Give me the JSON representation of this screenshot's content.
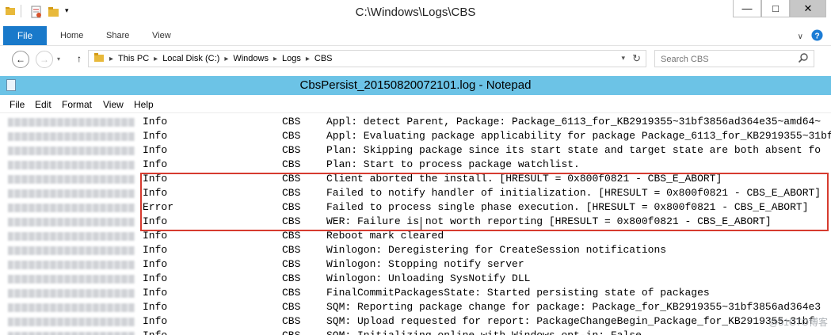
{
  "explorer": {
    "title": "C:\\Windows\\Logs\\CBS",
    "ribbon_tabs": [
      "File",
      "Home",
      "Share",
      "View"
    ],
    "address_crumbs": [
      "This PC",
      "Local Disk (C:)",
      "Windows",
      "Logs",
      "CBS"
    ],
    "search_placeholder": "Search CBS",
    "window_controls": {
      "minimize": "—",
      "maximize": "□",
      "close": "✕"
    },
    "icons": [
      "folder-icon",
      "properties-icon",
      "new-folder-icon",
      "customize-qat-icon",
      "back-arrow-icon",
      "forward-arrow-icon",
      "up-arrow-icon",
      "address-dropdown-icon",
      "refresh-icon",
      "search-icon",
      "ribbon-expand-icon",
      "help-icon"
    ]
  },
  "notepad": {
    "title": "CbsPersist_20150820072101.log - Notepad",
    "menu": [
      "File",
      "Edit",
      "Format",
      "View",
      "Help"
    ],
    "accent": "#6cc3e6",
    "highlight_color": "#d63b2f",
    "log_rows": [
      {
        "level": "Info",
        "component": "CBS",
        "message": "Appl: detect Parent, Package: Package_6113_for_KB2919355~31bf3856ad364e35~amd64~"
      },
      {
        "level": "Info",
        "component": "CBS",
        "message": "Appl: Evaluating package applicability for package Package_6113_for_KB2919355~31bf"
      },
      {
        "level": "Info",
        "component": "CBS",
        "message": "Plan: Skipping package since its start state and target state are both absent fo"
      },
      {
        "level": "Info",
        "component": "CBS",
        "message": "Plan: Start to process package watchlist."
      },
      {
        "level": "Info",
        "component": "CBS",
        "message": "Client aborted the install. [HRESULT = 0x800f0821 - CBS_E_ABORT]"
      },
      {
        "level": "Info",
        "component": "CBS",
        "message": "Failed to notify handler of initialization. [HRESULT = 0x800f0821 - CBS_E_ABORT]"
      },
      {
        "level": "Error",
        "component": "CBS",
        "message": "Failed to process single phase execution. [HRESULT = 0x800f0821 - CBS_E_ABORT]"
      },
      {
        "level": "Info",
        "component": "CBS",
        "message": "WER: Failure is not worth reporting [HRESULT = 0x800f0821 - CBS_E_ABORT]"
      },
      {
        "level": "Info",
        "component": "CBS",
        "message": "Reboot mark cleared"
      },
      {
        "level": "Info",
        "component": "CBS",
        "message": "Winlogon: Deregistering for CreateSession notifications"
      },
      {
        "level": "Info",
        "component": "CBS",
        "message": "Winlogon: Stopping notify server"
      },
      {
        "level": "Info",
        "component": "CBS",
        "message": "Winlogon: Unloading SysNotify DLL"
      },
      {
        "level": "Info",
        "component": "CBS",
        "message": "FinalCommitPackagesState: Started persisting state of packages"
      },
      {
        "level": "Info",
        "component": "CBS",
        "message": "SQM: Reporting package change for package: Package_for_KB2919355~31bf3856ad364e3"
      },
      {
        "level": "Info",
        "component": "CBS",
        "message": "SQM: Upload requested for report: PackageChangeBegin_Package_for_KB2919355~31bf"
      },
      {
        "level": "Info",
        "component": "CBS",
        "message": "SQM: Initializing online with Windows opt-in: False"
      }
    ]
  },
  "watermark": "@51CTO博客"
}
